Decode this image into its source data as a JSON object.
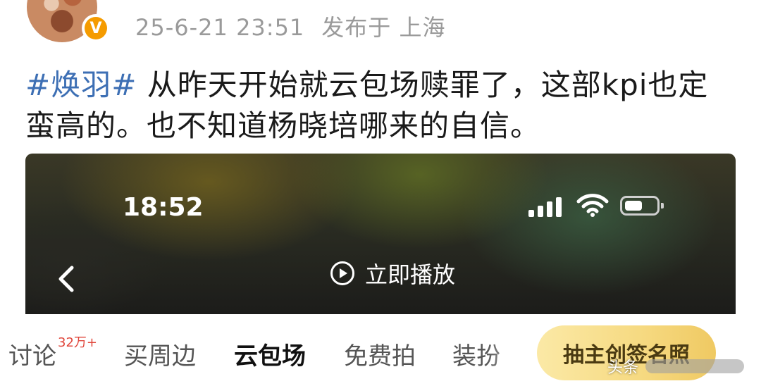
{
  "post": {
    "timestamp": "25-6-21 23:51",
    "location": "发布于 上海",
    "hashtag": "#焕羽#",
    "text_line1": " 从昨天开始就云包场赎罪了，这部kpi也定",
    "text_line2": "蛮高的。也不知道杨晓培哪来的自信。",
    "badge": "V"
  },
  "video": {
    "status_time": "18:52",
    "play_label": "立即播放",
    "icons": [
      "signal-icon",
      "wifi-icon",
      "battery-icon",
      "back-chevron-icon",
      "play-circle-icon"
    ]
  },
  "tabs": {
    "items": [
      {
        "label": "讨论"
      },
      {
        "label": "买周边"
      },
      {
        "label": "云包场"
      },
      {
        "label": "免费拍"
      },
      {
        "label": "装扮"
      }
    ],
    "discussion_count": "32万+",
    "draw_button": "抽主创签名照"
  },
  "watermark": {
    "brand": "头条"
  },
  "colors": {
    "hashtag": "#3d6fb4",
    "badge": "#f59b00",
    "pill_gold": "#f6d980",
    "count_red": "#e0463b"
  }
}
